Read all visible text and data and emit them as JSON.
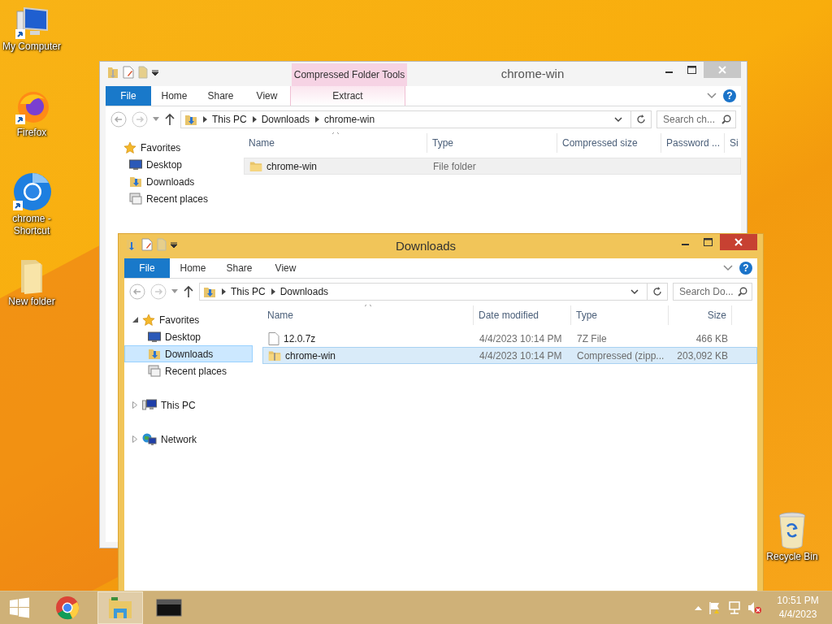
{
  "desktop_icons": [
    {
      "label": "My Computer",
      "kind": "computer"
    },
    {
      "label": "Firefox",
      "kind": "firefox"
    },
    {
      "label": "chrome - Shortcut",
      "kind": "chrome"
    },
    {
      "label": "New folder",
      "kind": "folder"
    }
  ],
  "recycle_bin": {
    "label": "Recycle Bin"
  },
  "windows": [
    {
      "title": "chrome-win",
      "active": false,
      "contextual_group": "Compressed Folder Tools",
      "ribbon_tabs": [
        {
          "label": "File",
          "kind": "file"
        },
        {
          "label": "Home",
          "kind": "plain"
        },
        {
          "label": "Share",
          "kind": "plain"
        },
        {
          "label": "View",
          "kind": "plain"
        },
        {
          "label": "Extract",
          "kind": "contextual"
        }
      ],
      "help": "?",
      "breadcrumb": [
        "This PC",
        "Downloads",
        "chrome-win"
      ],
      "search": {
        "placeholder": "Search ch..."
      },
      "nav": [
        {
          "label": "Favorites",
          "kind": "star",
          "children": [
            {
              "label": "Desktop",
              "kind": "desktop",
              "selected": false
            },
            {
              "label": "Downloads",
              "kind": "downloads",
              "selected": false
            },
            {
              "label": "Recent places",
              "kind": "recent",
              "selected": false
            }
          ]
        }
      ],
      "columns": [
        {
          "label": "Name",
          "kind": "text"
        },
        {
          "label": "Type",
          "kind": "text"
        },
        {
          "label": "Compressed size",
          "kind": "text"
        },
        {
          "label": "Password ...",
          "kind": "text"
        },
        {
          "label": "Si",
          "kind": "text"
        }
      ],
      "rows": [
        {
          "kind": "folder",
          "selected": true,
          "cells": [
            "chrome-win",
            "File folder"
          ]
        }
      ]
    },
    {
      "title": "Downloads",
      "active": true,
      "ribbon_tabs": [
        {
          "label": "File",
          "kind": "file"
        },
        {
          "label": "Home",
          "kind": "plain"
        },
        {
          "label": "Share",
          "kind": "plain"
        },
        {
          "label": "View",
          "kind": "plain"
        }
      ],
      "help": "?",
      "breadcrumb": [
        "This PC",
        "Downloads"
      ],
      "search": {
        "placeholder": "Search Do..."
      },
      "nav": [
        {
          "label": "Favorites",
          "kind": "star",
          "expanded": true,
          "children": [
            {
              "label": "Desktop",
              "kind": "desktop",
              "selected": false
            },
            {
              "label": "Downloads",
              "kind": "downloads",
              "selected": true
            },
            {
              "label": "Recent places",
              "kind": "recent",
              "selected": false
            }
          ]
        },
        {
          "label": "This PC",
          "kind": "computer",
          "expanded": false
        },
        {
          "label": "Network",
          "kind": "network",
          "expanded": false
        }
      ],
      "columns": [
        {
          "label": "Name",
          "kind": "text"
        },
        {
          "label": "Date modified",
          "kind": "text"
        },
        {
          "label": "Type",
          "kind": "text"
        },
        {
          "label": "Size",
          "kind": "number"
        }
      ],
      "rows": [
        {
          "kind": "file",
          "selected": false,
          "cells": [
            "12.0.7z",
            "4/4/2023 10:14 PM",
            "7Z File",
            "466 KB"
          ]
        },
        {
          "kind": "zip",
          "selected": true,
          "cells": [
            "chrome-win",
            "4/4/2023 10:14 PM",
            "Compressed (zipp...",
            "203,092 KB"
          ]
        }
      ]
    }
  ],
  "taskbar": {
    "apps": [
      {
        "kind": "chrome",
        "active": false
      },
      {
        "kind": "explorer",
        "active": true
      },
      {
        "kind": "console",
        "active": false
      }
    ],
    "time": "10:51 PM",
    "date": "4/4/2023"
  }
}
